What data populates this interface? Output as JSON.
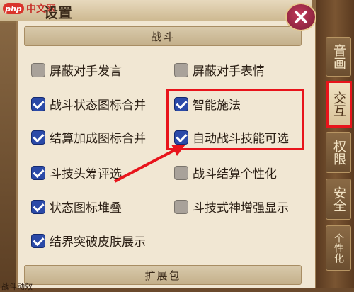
{
  "watermark": {
    "logo": "php",
    "text": "中文网"
  },
  "window": {
    "title": "设置"
  },
  "sections": {
    "battle": "战斗",
    "extension": "扩展包"
  },
  "options": [
    {
      "label": "屏蔽对手发言",
      "checked": false
    },
    {
      "label": "屏蔽对手表情",
      "checked": false
    },
    {
      "label": "战斗状态图标合并",
      "checked": true
    },
    {
      "label": "智能施法",
      "checked": true
    },
    {
      "label": "结算加成图标合并",
      "checked": true
    },
    {
      "label": "自动战斗技能可选",
      "checked": true
    },
    {
      "label": "斗技头筹评选",
      "checked": true
    },
    {
      "label": "战斗结算个性化",
      "checked": false
    },
    {
      "label": "状态图标堆叠",
      "checked": true
    },
    {
      "label": "斗技式神增强显示",
      "checked": false
    },
    {
      "label": "结界突破皮肤展示",
      "checked": true
    }
  ],
  "side_tabs": [
    {
      "label": "音画",
      "active": false
    },
    {
      "label": "交互",
      "active": true
    },
    {
      "label": "权限",
      "active": false
    },
    {
      "label": "安全",
      "active": false
    },
    {
      "label": "个性化",
      "active": false
    }
  ],
  "footer": {
    "text": "战斗动效"
  },
  "colors": {
    "checkbox_on": "#2b4aa8",
    "checkbox_off": "#a9a29a",
    "highlight": "#e8141b",
    "panel_bg": "#f1e7d3"
  }
}
